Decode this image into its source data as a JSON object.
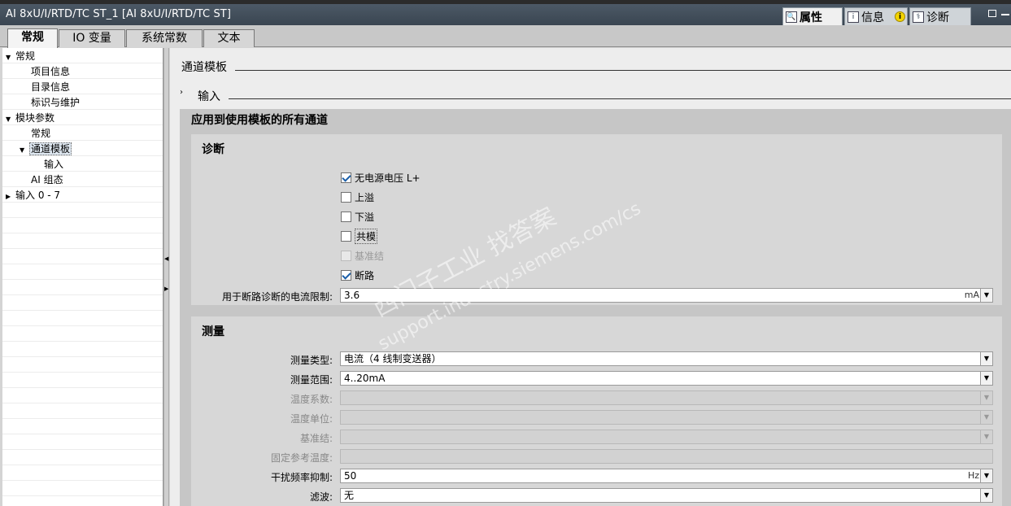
{
  "window": {
    "title": "AI 8xU/I/RTD/TC ST_1 [AI 8xU/I/RTD/TC ST]"
  },
  "panel_tabs": [
    {
      "label": "属性",
      "icon": "properties-icon",
      "active": true
    },
    {
      "label": "信息",
      "icon": "info-icon",
      "active": false
    },
    {
      "label": "诊断",
      "icon": "diagnostics-icon",
      "active": false
    }
  ],
  "main_tabs": [
    {
      "label": "常规",
      "active": true
    },
    {
      "label": "IO 变量",
      "active": false
    },
    {
      "label": "系统常数",
      "active": false
    },
    {
      "label": "文本",
      "active": false
    }
  ],
  "tree": [
    {
      "label": "常规",
      "expanded": true
    },
    {
      "label": "项目信息"
    },
    {
      "label": "目录信息"
    },
    {
      "label": "标识与维护"
    },
    {
      "label": "模块参数",
      "expanded": true
    },
    {
      "label": "常规"
    },
    {
      "label": "通道模板",
      "expanded": true,
      "selected": true
    },
    {
      "label": "输入"
    },
    {
      "label": "AI 组态"
    },
    {
      "label": "输入 0 - 7",
      "expanded": false
    }
  ],
  "content": {
    "section_title": "通道模板",
    "subsection_title": "输入",
    "group_title": "应用到使用模板的所有通道",
    "diagnostics": {
      "title": "诊断",
      "checkboxes": [
        {
          "label": "无电源电压 L+",
          "checked": true,
          "enabled": true
        },
        {
          "label": "上溢",
          "checked": false,
          "enabled": true
        },
        {
          "label": "下溢",
          "checked": false,
          "enabled": true
        },
        {
          "label": "共模",
          "checked": false,
          "enabled": true
        },
        {
          "label": "基准结",
          "checked": false,
          "enabled": false
        },
        {
          "label": "断路",
          "checked": true,
          "enabled": true
        }
      ],
      "wire_break_limit": {
        "label": "用于断路诊断的电流限制:",
        "value": "3.6",
        "unit": "mA"
      }
    },
    "measurement": {
      "title": "测量",
      "fields": [
        {
          "label": "测量类型:",
          "value": "电流（4 线制变送器）",
          "enabled": true,
          "unit": ""
        },
        {
          "label": "测量范围:",
          "value": "4..20mA",
          "enabled": true,
          "unit": ""
        },
        {
          "label": "温度系数:",
          "value": "",
          "enabled": false,
          "unit": ""
        },
        {
          "label": "温度单位:",
          "value": "",
          "enabled": false,
          "unit": ""
        },
        {
          "label": "基准结:",
          "value": "",
          "enabled": false,
          "unit": ""
        },
        {
          "label": "固定参考温度:",
          "value": "",
          "enabled": false,
          "unit": ""
        },
        {
          "label": "干扰频率抑制:",
          "value": "50",
          "enabled": true,
          "unit": "Hz"
        },
        {
          "label": "滤波:",
          "value": "无",
          "enabled": true,
          "unit": ""
        }
      ]
    }
  },
  "watermark": {
    "line1": "西门子工业  找答案",
    "line2": "support.industry.siemens.com/cs"
  }
}
